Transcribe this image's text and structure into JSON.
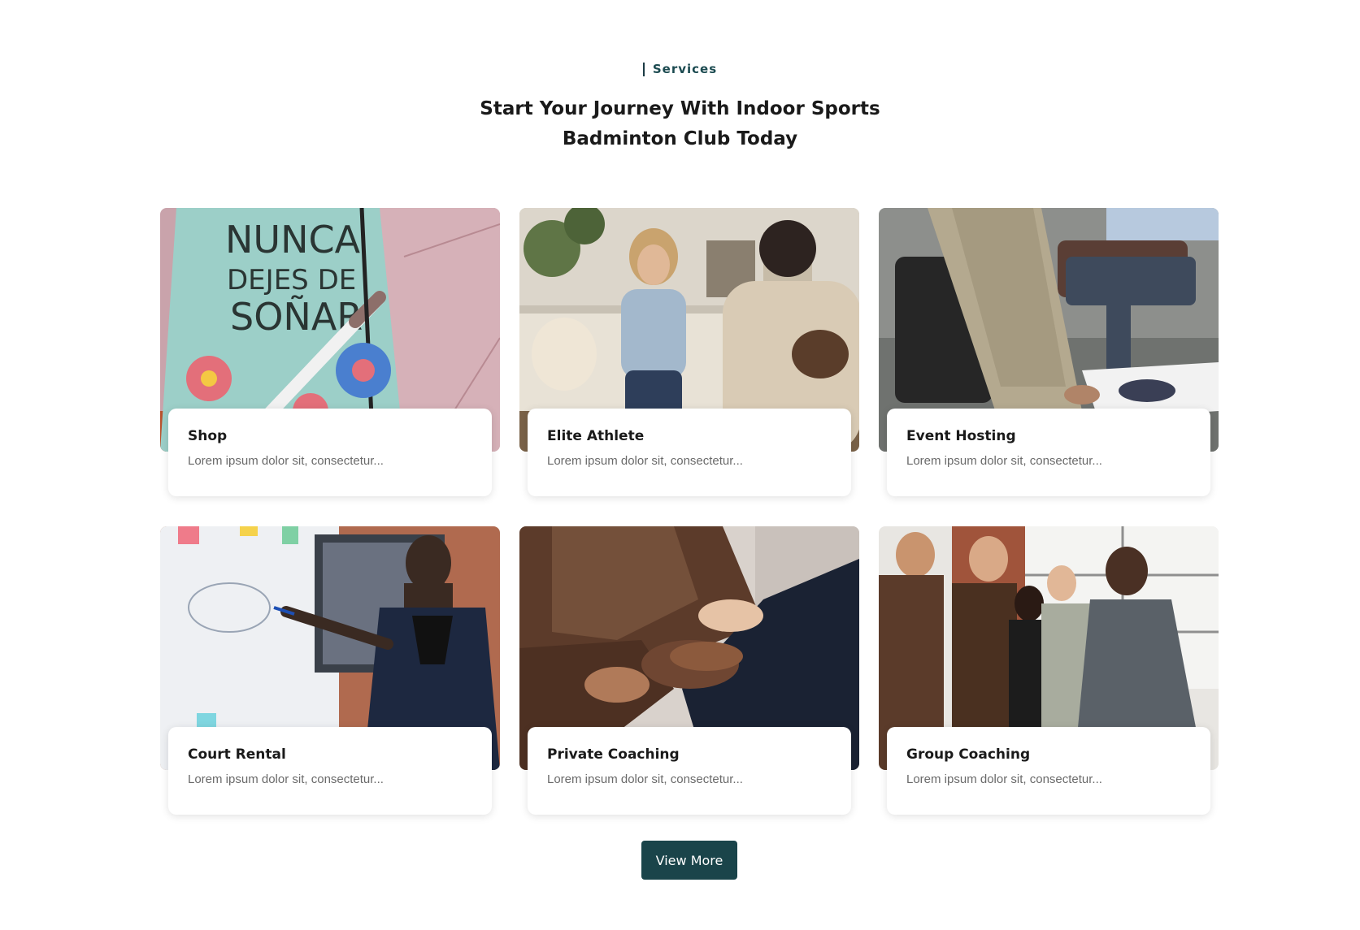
{
  "section": {
    "eyebrow": "Services",
    "heading_line1": "Start Your Journey With Indoor Sports",
    "heading_line2": "Badminton Club Today"
  },
  "cards": [
    {
      "title": "Shop",
      "desc": "Lorem ipsum dolor sit, consectetur...",
      "photo": "notebook-with-pen"
    },
    {
      "title": "Elite Athlete",
      "desc": "Lorem ipsum dolor sit, consectetur...",
      "photo": "woman-on-couch"
    },
    {
      "title": "Event Hosting",
      "desc": "Lorem ipsum dolor sit, consectetur...",
      "photo": "office-meeting"
    },
    {
      "title": "Court Rental",
      "desc": "Lorem ipsum dolor sit, consectetur...",
      "photo": "woman-presenting-whiteboard"
    },
    {
      "title": "Private Coaching",
      "desc": "Lorem ipsum dolor sit, consectetur...",
      "photo": "handshake"
    },
    {
      "title": "Group Coaching",
      "desc": "Lorem ipsum dolor sit, consectetur...",
      "photo": "group-greeting"
    }
  ],
  "photo_text": {
    "notebook": [
      "NUNCA",
      "DEJES DE",
      "SOÑAR"
    ]
  },
  "cta": {
    "label": "View More"
  },
  "colors": {
    "accent": "#1a444a",
    "eyebrow": "#1b4a50"
  }
}
